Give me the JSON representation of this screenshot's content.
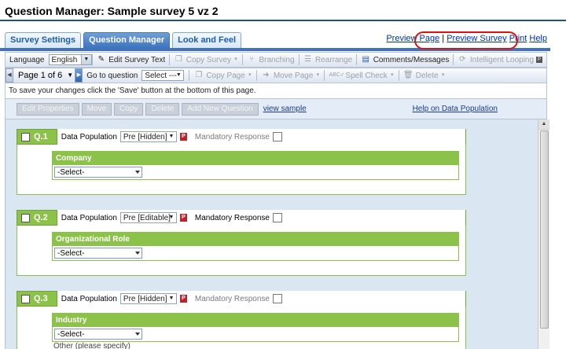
{
  "page": {
    "title": "Question Manager:  Sample survey 5 vz 2"
  },
  "tabs": [
    {
      "label": "Survey Settings",
      "active": false
    },
    {
      "label": "Question Manager",
      "active": true
    },
    {
      "label": "Look and Feel",
      "active": false
    }
  ],
  "links": {
    "preview_page": "Preview Page",
    "separator": "|",
    "preview_survey": "Preview Survey",
    "print": "Print",
    "help": "Help"
  },
  "toolbar1": {
    "language_label": "Language",
    "language_value": "English",
    "edit_survey_text": "Edit Survey Text",
    "copy_survey": "Copy Survey",
    "branching": "Branching",
    "rearrange": "Rearrange",
    "comments_messages": "Comments/Messages",
    "intelligent_looping": "Intelligent Looping"
  },
  "toolbar2": {
    "page_indicator": "Page 1 of 6",
    "go_to_question_label": "Go to question",
    "go_to_question_value": "Select ---",
    "copy_page": "Copy Page",
    "move_page": "Move Page",
    "spell_check": "Spell Check",
    "delete": "Delete"
  },
  "info_text": "To save your changes click the 'Save' button at the bottom of this page.",
  "editor_bar": {
    "buttons": [
      "Edit Properties",
      "Move",
      "Copy",
      "Delete",
      "Add New Question"
    ],
    "view_sample": "view sample",
    "help_link": "Help on Data Population"
  },
  "questions": [
    {
      "number": "Q.1",
      "dp_label": "Data Population",
      "dp_value": "Pre [Hidden]",
      "mandatory_label": "Mandatory Response",
      "title": "Company",
      "select_value": "-Select-"
    },
    {
      "number": "Q.2",
      "dp_label": "Data Population",
      "dp_value": "Pre [Editable]",
      "mandatory_label": "Mandatory Response",
      "title": "Organizational Role",
      "select_value": "-Select-"
    },
    {
      "number": "Q.3",
      "dp_label": "Data Population",
      "dp_value": "Pre [Hidden]",
      "mandatory_label": "Mandatory Response",
      "title": "Industry",
      "select_value": "-Select-",
      "other_text": "Other (please specify)"
    }
  ],
  "colors": {
    "accent": "#3d74bd",
    "question_green": "#8cc24a",
    "highlight_oval": "#e01010"
  }
}
